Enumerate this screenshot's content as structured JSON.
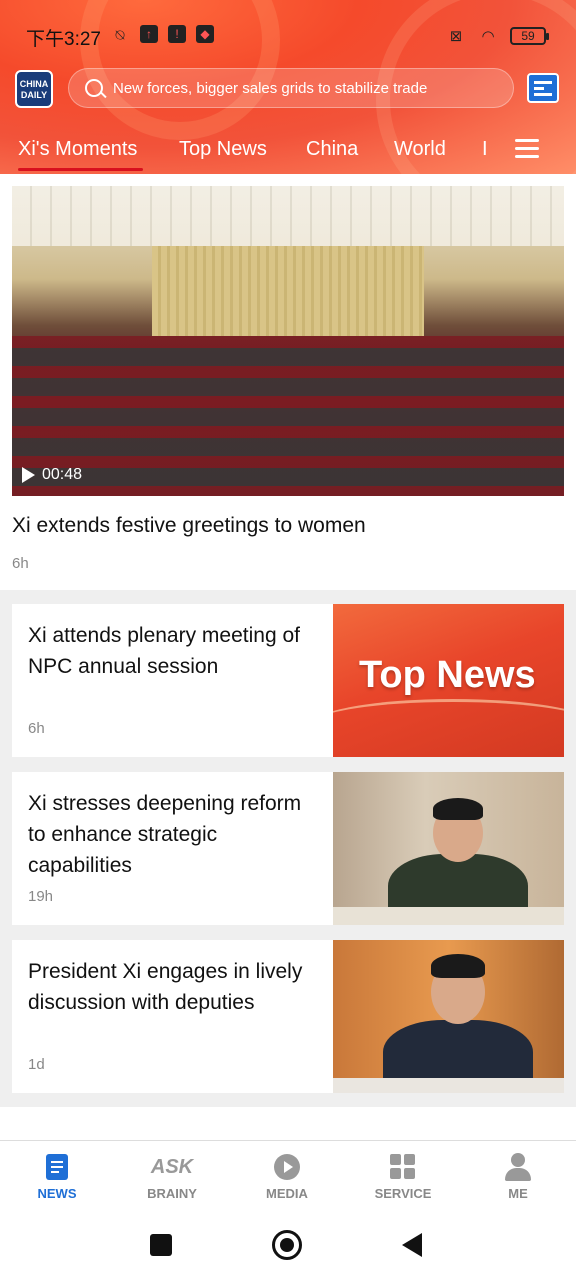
{
  "status_bar": {
    "time": "下午3:27",
    "battery": "59"
  },
  "header": {
    "logo_text": "CHINA DAILY",
    "search_placeholder": "New forces, bigger sales grids to stabilize trade",
    "tabs": [
      {
        "label": "Xi's Moments",
        "active": true
      },
      {
        "label": "Top News",
        "active": false
      },
      {
        "label": "China",
        "active": false
      },
      {
        "label": "World",
        "active": false
      },
      {
        "label": "I",
        "active": false
      }
    ]
  },
  "feature": {
    "video_duration": "00:48",
    "title": "Xi extends festive greetings to women",
    "time": "6h"
  },
  "articles": [
    {
      "title": "Xi attends plenary meeting of NPC annual session",
      "time": "6h",
      "thumb": "top-news",
      "thumb_label": "Top News"
    },
    {
      "title": "Xi stresses deepening reform to enhance strategic capabilities",
      "time": "19h",
      "thumb": "portrait"
    },
    {
      "title": "President Xi engages in lively discussion with deputies",
      "time": "1d",
      "thumb": "portrait"
    }
  ],
  "bottom_nav": [
    {
      "label": "NEWS",
      "icon": "news-icon",
      "active": true
    },
    {
      "label": "BRAINY",
      "icon": "ask-icon",
      "active": false
    },
    {
      "label": "MEDIA",
      "icon": "play-icon",
      "active": false
    },
    {
      "label": "SERVICE",
      "icon": "grid-icon",
      "active": false
    },
    {
      "label": "ME",
      "icon": "person-icon",
      "active": false
    }
  ],
  "colors": {
    "accent": "#1f6fd6",
    "header_red": "#f54a2b",
    "tab_underline": "#d8101e"
  }
}
